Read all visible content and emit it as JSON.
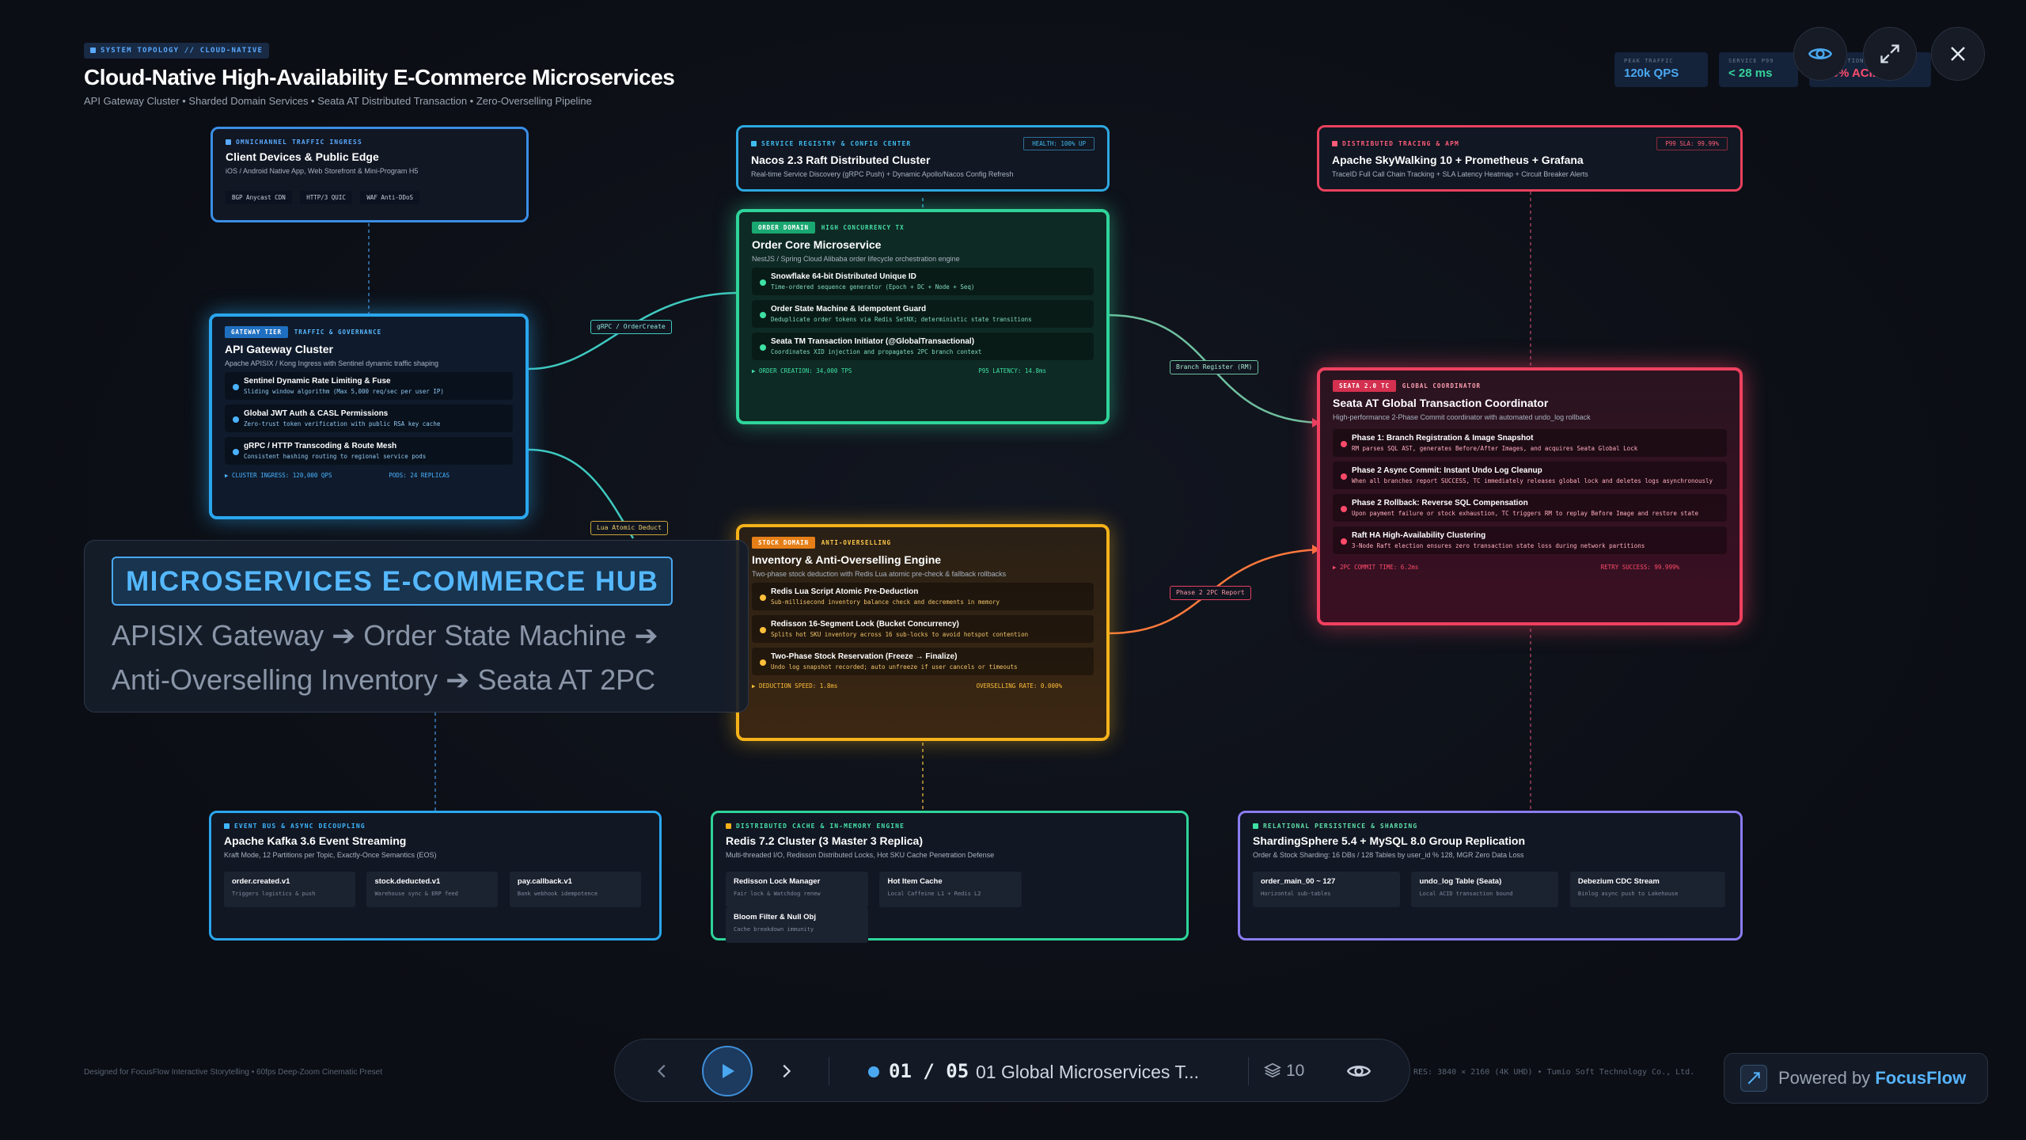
{
  "header": {
    "tag": "SYSTEM TOPOLOGY // CLOUD-NATIVE",
    "title": "Cloud-Native High-Availability E-Commerce Microservices",
    "subtitle": "API Gateway Cluster • Sharded Domain Services • Seata AT Distributed Transaction • Zero-Overselling Pipeline"
  },
  "kpis": [
    {
      "label": "PEAK TRAFFIC",
      "value": "120k QPS",
      "color": "#4aa8f0"
    },
    {
      "label": "SERVICE P99",
      "value": "< 28 ms",
      "color": "#36d39a"
    },
    {
      "label": "TRANSACTION SUCCESS",
      "value": "100% ACID",
      "color": "#ff4d6d"
    }
  ],
  "controls": {
    "eye_icon": "eye-icon",
    "expand_icon": "expand-icon",
    "close_icon": "close-icon"
  },
  "connectors": {
    "grpc": "gRPC / OrderCreate",
    "lua": "Lua Atomic Deduct",
    "branch": "Branch Register (RM)",
    "phase2": "Phase 2 2PC Report"
  },
  "cards": {
    "ingress": {
      "tag": "OMNICHANNEL TRAFFIC INGRESS",
      "title": "Client Devices & Public Edge",
      "sub": "iOS / Android Native App, Web Storefront & Mini-Program H5",
      "chips": [
        "BGP Anycast CDN",
        "HTTP/3 QUIC",
        "WAF Anti-DDoS"
      ]
    },
    "registry": {
      "tag": "SERVICE REGISTRY & CONFIG CENTER",
      "health": "HEALTH: 100% UP",
      "title": "Nacos 2.3 Raft Distributed Cluster",
      "sub": "Real-time Service Discovery (gRPC Push) + Dynamic Apollo/Nacos Config Refresh"
    },
    "tracing": {
      "tag": "DISTRIBUTED TRACING & APM",
      "sla": "P99 SLA: 99.99%",
      "title": "Apache SkyWalking 10 + Prometheus + Grafana",
      "sub": "TraceID Full Call Chain Tracking + SLA Latency Heatmap + Circuit Breaker Alerts"
    },
    "gateway": {
      "pill": "GATEWAY TIER",
      "label": "TRAFFIC & GOVERNANCE",
      "title": "API Gateway Cluster",
      "sub": "Apache APISIX / Kong Ingress with Sentinel dynamic traffic shaping",
      "items": [
        {
          "title": "Sentinel Dynamic Rate Limiting & Fuse",
          "desc": "Sliding window algorithm (Max 5,000 req/sec per user IP)"
        },
        {
          "title": "Global JWT Auth & CASL Permissions",
          "desc": "Zero-trust token verification with public RSA key cache"
        },
        {
          "title": "gRPC / HTTP Transcoding & Route Mesh",
          "desc": "Consistent hashing routing to regional service pods"
        }
      ],
      "foot_left": "▶ CLUSTER INGRESS: 120,000 QPS",
      "foot_right": "PODS: 24 REPLICAS"
    },
    "order": {
      "pill": "ORDER DOMAIN",
      "label": "HIGH CONCURRENCY TX",
      "title": "Order Core Microservice",
      "sub": "NestJS / Spring Cloud Alibaba order lifecycle orchestration engine",
      "items": [
        {
          "title": "Snowflake 64-bit Distributed Unique ID",
          "desc": "Time-ordered sequence generator (Epoch + DC + Node + Seq)"
        },
        {
          "title": "Order State Machine & Idempotent Guard",
          "desc": "Deduplicate order tokens via Redis SetNX; deterministic state transitions"
        },
        {
          "title": "Seata TM Transaction Initiator (@GlobalTransactional)",
          "desc": "Coordinates XID injection and propagates 2PC branch context"
        }
      ],
      "foot_left": "▶ ORDER CREATION: 34,000 TPS",
      "foot_right": "P95 LATENCY: 14.8ms"
    },
    "inventory": {
      "pill": "STOCK DOMAIN",
      "label": "ANTI-OVERSELLING",
      "title": "Inventory & Anti-Overselling Engine",
      "sub": "Two-phase stock deduction with Redis Lua atomic pre-check & fallback rollbacks",
      "items": [
        {
          "title": "Redis Lua Script Atomic Pre-Deduction",
          "desc": "Sub-millisecond inventory balance check and decrements in memory"
        },
        {
          "title": "Redisson 16-Segment Lock (Bucket Concurrency)",
          "desc": "Splits hot SKU inventory across 16 sub-locks to avoid hotspot contention"
        },
        {
          "title": "Two-Phase Stock Reservation (Freeze → Finalize)",
          "desc": "Undo log snapshot recorded; auto unfreeze if user cancels or timeouts"
        }
      ],
      "foot_left": "▶ DEDUCTION SPEED: 1.8ms",
      "foot_right": "OVERSELLING RATE: 0.000%"
    },
    "seata": {
      "pill": "SEATA 2.0 TC",
      "label": "GLOBAL COORDINATOR",
      "title": "Seata AT Global Transaction Coordinator",
      "sub": "High-performance 2-Phase Commit coordinator with automated undo_log rollback",
      "items": [
        {
          "title": "Phase 1: Branch Registration & Image Snapshot",
          "desc": "RM parses SQL AST, generates Before/After Images, and acquires Seata Global Lock"
        },
        {
          "title": "Phase 2 Async Commit: Instant Undo Log Cleanup",
          "desc": "When all branches report SUCCESS, TC immediately releases global lock and deletes logs asynchronously"
        },
        {
          "title": "Phase 2 Rollback: Reverse SQL Compensation",
          "desc": "Upon payment failure or stock exhaustion, TC triggers RM to replay Before Image and restore state"
        },
        {
          "title": "Raft HA High-Availability Clustering",
          "desc": "3-Node Raft election ensures zero transaction state loss during network partitions"
        }
      ],
      "foot_left": "▶ 2PC COMMIT TIME: 6.2ms",
      "foot_right": "RETRY SUCCESS: 99.999%"
    },
    "kafka": {
      "tag": "EVENT BUS & ASYNC DECOUPLING",
      "title": "Apache Kafka 3.6 Event Streaming",
      "sub": "Kraft Mode, 12 Partitions per Topic, Exactly-Once Semantics (EOS)",
      "boxes": [
        {
          "title": "order.created.v1",
          "desc": "Triggers logistics & push"
        },
        {
          "title": "stock.deducted.v1",
          "desc": "Warehouse sync & ERP feed"
        },
        {
          "title": "pay.callback.v1",
          "desc": "Bank webhook idempotence"
        }
      ]
    },
    "redis": {
      "tag": "DISTRIBUTED CACHE & IN-MEMORY ENGINE",
      "title": "Redis 7.2 Cluster (3 Master 3 Replica)",
      "sub": "Multi-threaded I/O, Redisson Distributed Locks, Hot SKU Cache Penetration Defense",
      "boxes": [
        {
          "title": "Redisson Lock Manager",
          "desc": "Fair lock & Watchdog renew"
        },
        {
          "title": "Hot Item Cache",
          "desc": "Local Caffeine L1 + Redis L2"
        },
        {
          "title": "Bloom Filter & Null Obj",
          "desc": "Cache breakdown immunity"
        }
      ]
    },
    "sharding": {
      "tag": "RELATIONAL PERSISTENCE & SHARDING",
      "title": "ShardingSphere 5.4 + MySQL 8.0 Group Replication",
      "sub": "Order & Stock Sharding: 16 DBs / 128 Tables by user_id % 128, MGR Zero Data Loss",
      "boxes": [
        {
          "title": "order_main_00 ~ 127",
          "desc": "Horizontal sub-tables"
        },
        {
          "title": "undo_log Table (Seata)",
          "desc": "Local ACID transaction bound"
        },
        {
          "title": "Debezium CDC Stream",
          "desc": "Binlog async push to Lakehouse"
        }
      ]
    }
  },
  "hub": {
    "title": "MICROSERVICES E-COMMERCE HUB",
    "line1": "APISIX Gateway ➔ Order State Machine ➔",
    "line2": "Anti-Overselling Inventory ➔ Seata AT 2PC"
  },
  "footer": {
    "credit": "Designed for FocusFlow Interactive Storytelling • 60fps Deep-Zoom Cinematic Preset",
    "credit_right": "RES: 3840 × 2160 (4K UHD) • Tumio Soft Technology Co., Ltd."
  },
  "player": {
    "current": "01",
    "sep": "/",
    "total": "05",
    "slide_name": "01 Global Microservices T...",
    "layers": "10",
    "prev_icon": "chevron-left-icon",
    "play_icon": "play-icon",
    "next_icon": "chevron-right-icon",
    "layers_icon": "layers-icon",
    "eye_icon": "eye-icon"
  },
  "powered": {
    "prefix": "Powered by",
    "brand": "FocusFlow"
  }
}
